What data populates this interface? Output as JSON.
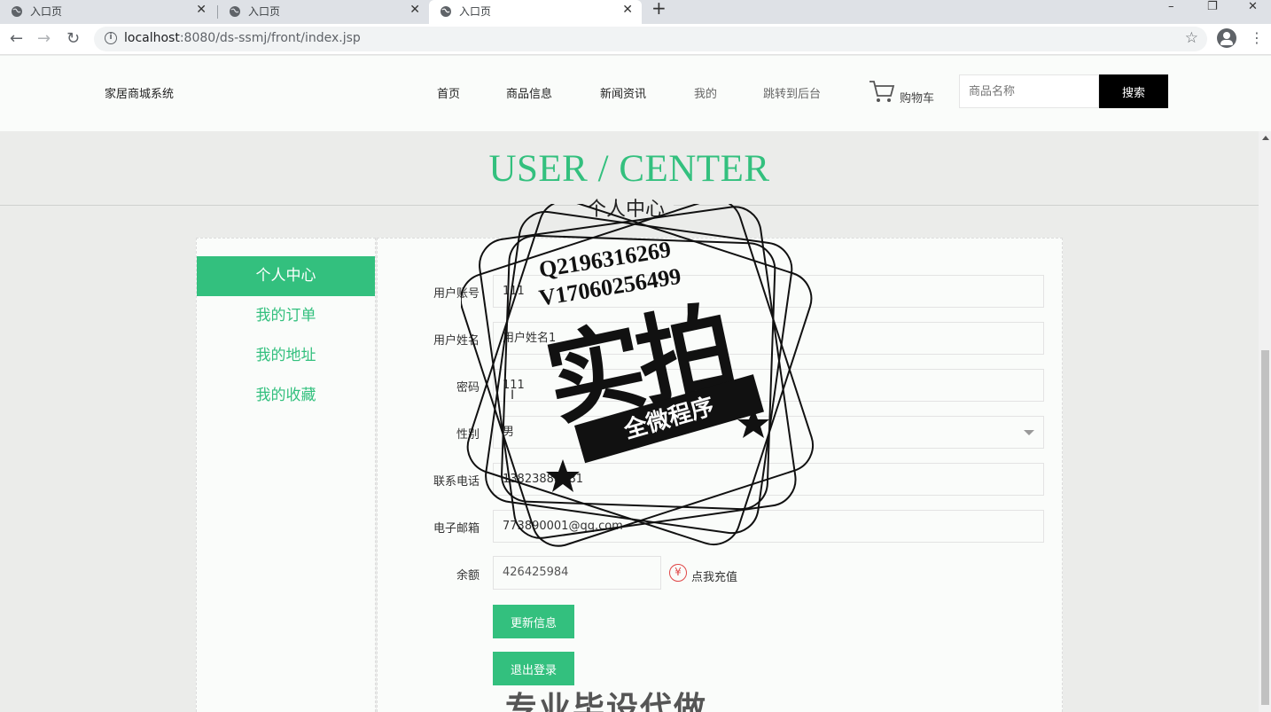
{
  "browser": {
    "tabs": [
      {
        "title": "入口页",
        "active": false
      },
      {
        "title": "入口页",
        "active": false
      },
      {
        "title": "入口页",
        "active": true
      }
    ],
    "new_tab": "+",
    "url_host": "localhost",
    "url_rest": ":8080/ds-ssmj/front/index.jsp",
    "window_controls": {
      "minimize": "–",
      "restore": "❐",
      "close": "✕"
    }
  },
  "header": {
    "logo": "家居商城系统",
    "nav": [
      "首页",
      "商品信息",
      "新闻资讯",
      "我的",
      "跳转到后台"
    ],
    "cart_label": "购物车",
    "search_placeholder": "商品名称",
    "search_button": "搜索"
  },
  "section": {
    "title_en": "USER / CENTER",
    "title_cn": "个人中心"
  },
  "sidebar": {
    "items": [
      {
        "label": "个人中心",
        "active": true
      },
      {
        "label": "我的订单",
        "active": false
      },
      {
        "label": "我的地址",
        "active": false
      },
      {
        "label": "我的收藏",
        "active": false
      }
    ]
  },
  "form": {
    "account": {
      "label": "用户账号",
      "value": "111"
    },
    "name": {
      "label": "用户姓名",
      "value": "用户姓名1"
    },
    "password": {
      "label": "密码",
      "value": "111"
    },
    "gender": {
      "label": "性别",
      "value": "男"
    },
    "phone": {
      "label": "联系电话",
      "value": "13823888881"
    },
    "email": {
      "label": "电子邮箱",
      "value": "773890001@qq.com"
    },
    "balance": {
      "label": "余额",
      "value": "426425984"
    },
    "recharge_label": "点我充值",
    "currency_symbol": "¥",
    "update_button": "更新信息",
    "logout_button": "退出登录"
  },
  "watermark": {
    "line1": "Q2196316269",
    "line2": "V17060256499",
    "big": "实拍",
    "ribbon": "全微程序",
    "bottom": "专业毕设代做"
  },
  "colors": {
    "accent": "#33c07e",
    "page_bg": "#ebecea",
    "panel_bg": "#fafcfa",
    "search_btn": "#000000"
  }
}
